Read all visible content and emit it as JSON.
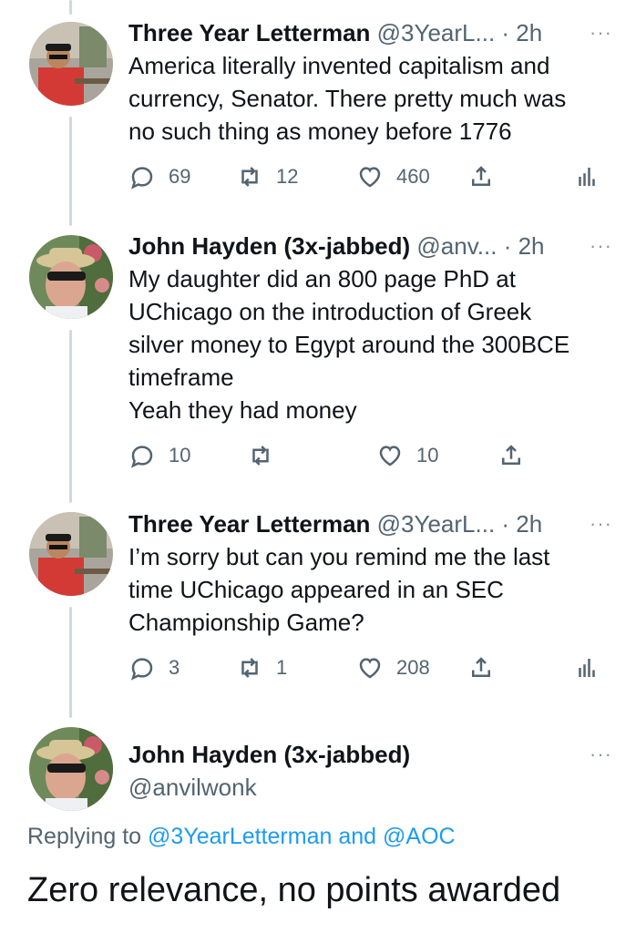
{
  "tweets": [
    {
      "name": "Three Year Letterman",
      "handle": "@3YearL...",
      "time": "· 2h",
      "text": "America literally invented capitalism and\ncurrency, Senator. There pretty much was\nno such thing as money before 1776",
      "replies": "69",
      "retweets": "12",
      "likes": "460"
    },
    {
      "name": "John Hayden (3x-jabbed)",
      "handle": "@anv...",
      "time": "· 2h",
      "text": "My daughter did an 800 page PhD at\nUChicago on the introduction of Greek\nsilver money to Egypt around the 300BCE\ntimeframe\nYeah they had money",
      "replies": "10",
      "retweets": "",
      "likes": "10"
    },
    {
      "name": "Three Year Letterman",
      "handle": "@3YearL...",
      "time": "· 2h",
      "text": "I’m sorry but can you remind me the last\ntime UChicago appeared in an SEC\nChampionship Game?",
      "replies": "3",
      "retweets": "1",
      "likes": "208"
    }
  ],
  "main_tweet": {
    "name": "John Hayden (3x-jabbed)",
    "handle": "@anvilwonk",
    "replying_prefix": "Replying to",
    "mention_1": "@3YearLetterman",
    "and_word": "and",
    "mention_2": "@AOC",
    "text": "Zero relevance, no points awarded"
  },
  "more_glyph": "···",
  "colors": {
    "link": "#1d9bf0",
    "secondary_text": "#536471",
    "thread_line": "#cfd9de"
  },
  "icons": [
    "reply-icon",
    "retweet-icon",
    "like-icon",
    "share-icon",
    "analytics-icon",
    "more-icon"
  ]
}
